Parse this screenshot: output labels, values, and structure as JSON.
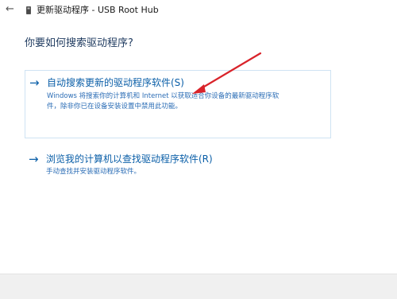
{
  "window": {
    "title": "更新驱动程序 - USB Root Hub",
    "back_glyph": "←"
  },
  "heading": "你要如何搜索驱动程序?",
  "options": [
    {
      "arrow": "→",
      "title": "自动搜索更新的驱动程序软件(S)",
      "description_lines": [
        "Windows 将搜索你的计算机和 Internet 以获取适合你设备的最新驱动程序软",
        "件，除非你已在设备安装设置中禁用此功能。"
      ]
    },
    {
      "arrow": "→",
      "title": "浏览我的计算机以查找驱动程序软件(R)",
      "description": "手动查找并安装驱动程序软件。"
    }
  ],
  "colors": {
    "accent": "#0b5fa8",
    "annotation": "#d9232a",
    "footer": "#f0f0f0"
  }
}
